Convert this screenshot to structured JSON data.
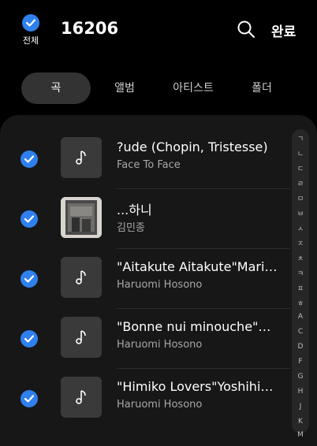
{
  "header": {
    "select_all_label": "전체",
    "count": "16206",
    "done_label": "완료"
  },
  "tabs": [
    "곡",
    "앨범",
    "아티스트",
    "폴더"
  ],
  "songs": [
    {
      "title": "?ude (Chopin, Tristesse)",
      "artist": "Face To Face",
      "thumb": "note-icon"
    },
    {
      "title": "...하니",
      "artist": "김민종",
      "thumb": "album-art"
    },
    {
      "title": "\"Aitakute Aitakute\"Mari…",
      "artist": "Haruomi Hosono",
      "thumb": "note-icon"
    },
    {
      "title": "\"Bonne nui minouche\"…",
      "artist": "Haruomi Hosono",
      "thumb": "note-icon"
    },
    {
      "title": "\"Himiko Lovers\"Yoshihi…",
      "artist": "Haruomi Hosono",
      "thumb": "note-icon"
    }
  ],
  "index_letters": [
    "ㄱ",
    "ㄴ",
    "ㄷ",
    "ㄹ",
    "ㅁ",
    "ㅂ",
    "ㅅ",
    "ㅈ",
    "ㅊ",
    "ㅋ",
    "ㅍ",
    "ㅎ",
    "A",
    "C",
    "D",
    "F",
    "G",
    "H",
    "J",
    "K",
    "M"
  ],
  "colors": {
    "accent": "#2f80ed",
    "background": "#000000",
    "panel": "#171717"
  }
}
